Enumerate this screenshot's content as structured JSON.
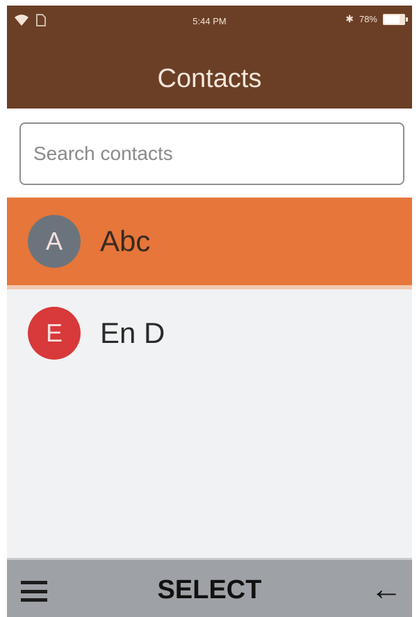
{
  "status_bar": {
    "time": "5:44 PM",
    "battery": "78%",
    "battery_level": 0.78,
    "icons": [
      "wifi-icon",
      "sim-icon",
      "bluetooth-icon",
      "battery-icon"
    ]
  },
  "header": {
    "title": "Contacts"
  },
  "search": {
    "placeholder": "Search contacts",
    "value": ""
  },
  "contacts": [
    {
      "initial": "A",
      "name": "Abc",
      "avatar_color": "#6b747c",
      "selected": true
    },
    {
      "initial": "E",
      "name": "En D",
      "avatar_color": "#d8393a",
      "selected": false
    }
  ],
  "softkeys": {
    "left_icon": "menu-icon",
    "center": "SELECT",
    "right_icon": "back-arrow-icon"
  },
  "colors": {
    "header_bg": "#6b3f26",
    "selected_row": "#e6763a",
    "softkey_bg": "#9ea1a5"
  }
}
